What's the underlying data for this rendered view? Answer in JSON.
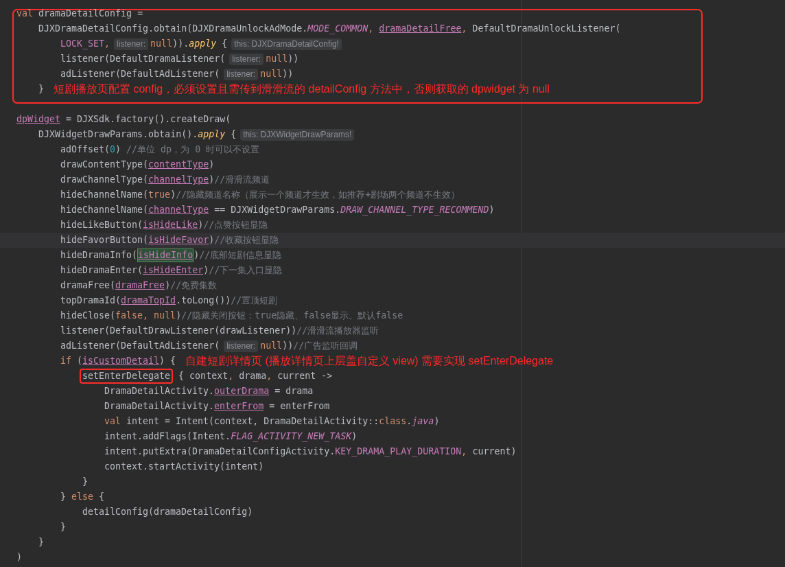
{
  "editor": {
    "blocks": [
      {
        "framed": true,
        "lines": [
          {
            "current": false,
            "tokens": [
              {
                "kind": "keyword",
                "text": "val"
              },
              {
                "kind": "plain",
                "text": " dramaDetailConfig ="
              }
            ],
            "children": [
              {
                "current": false,
                "tokens": [
                  {
                    "kind": "plain",
                    "text": "DJXDramaDetailConfig.obtain(DJXDramaUnlockAdMode."
                  },
                  {
                    "kind": "constant",
                    "text": "MODE_COMMON"
                  },
                  {
                    "kind": "keyword",
                    "text": ", "
                  },
                  {
                    "kind": "property",
                    "text": "dramaDetailFree"
                  },
                  {
                    "kind": "keyword",
                    "text": ","
                  },
                  {
                    "kind": "plain",
                    "text": " DefaultDramaUnlockListener("
                  }
                ],
                "children": [
                  {
                    "current": false,
                    "tokens": [
                      {
                        "kind": "field",
                        "text": "LOCK_SET"
                      },
                      {
                        "kind": "keyword",
                        "text": ","
                      },
                      {
                        "kind": "hint",
                        "text": "listener:"
                      },
                      {
                        "kind": "keyword",
                        "text": "null"
                      },
                      {
                        "kind": "plain",
                        "text": "))."
                      },
                      {
                        "kind": "call",
                        "text": "apply"
                      },
                      {
                        "kind": "plain",
                        "text": " {"
                      },
                      {
                        "kind": "hint",
                        "text": "this: DJXDramaDetailConfig!"
                      }
                    ]
                  },
                  {
                    "current": false,
                    "tokens": [
                      {
                        "kind": "plain",
                        "text": "listener(DefaultDramaListener("
                      },
                      {
                        "kind": "hint",
                        "text": "listener:"
                      },
                      {
                        "kind": "keyword",
                        "text": "null"
                      },
                      {
                        "kind": "plain",
                        "text": "))"
                      }
                    ]
                  },
                  {
                    "current": false,
                    "tokens": [
                      {
                        "kind": "plain",
                        "text": "adListener(DefaultAdListener("
                      },
                      {
                        "kind": "hint",
                        "text": "listener:"
                      },
                      {
                        "kind": "keyword",
                        "text": "null"
                      },
                      {
                        "kind": "plain",
                        "text": "))"
                      }
                    ]
                  }
                ]
              },
              {
                "current": false,
                "tokens": [
                  {
                    "kind": "plain",
                    "text": "}"
                  },
                  {
                    "kind": "note",
                    "text": "短剧播放页配置 config，必须设置且需传到滑滑流的 detailConfig 方法中，否则获取的 dpwidget 为 null"
                  }
                ]
              }
            ]
          }
        ]
      },
      {
        "framed": false,
        "lines": [
          {
            "current": false,
            "tokens": [
              {
                "kind": "property",
                "text": "dpWidget"
              },
              {
                "kind": "plain",
                "text": " = DJXSdk.factory().createDraw("
              }
            ],
            "children": [
              {
                "current": false,
                "tokens": [
                  {
                    "kind": "plain",
                    "text": "DJXWidgetDrawParams.obtain()."
                  },
                  {
                    "kind": "call",
                    "text": "apply"
                  },
                  {
                    "kind": "plain",
                    "text": " {"
                  },
                  {
                    "kind": "hint",
                    "text": "this: DJXWidgetDrawParams!"
                  }
                ],
                "children": [
                  {
                    "current": false,
                    "tokens": [
                      {
                        "kind": "plain",
                        "text": "adOffset("
                      },
                      {
                        "kind": "number",
                        "text": "0"
                      },
                      {
                        "kind": "plain",
                        "text": ")"
                      },
                      {
                        "kind": "comment",
                        "text": " //单位 dp，为 0 时可以不设置"
                      }
                    ]
                  },
                  {
                    "current": false,
                    "tokens": [
                      {
                        "kind": "plain",
                        "text": "drawContentType("
                      },
                      {
                        "kind": "property",
                        "text": "contentType"
                      },
                      {
                        "kind": "plain",
                        "text": ")"
                      }
                    ]
                  },
                  {
                    "current": false,
                    "tokens": [
                      {
                        "kind": "plain",
                        "text": "drawChannelType("
                      },
                      {
                        "kind": "property",
                        "text": "channelType"
                      },
                      {
                        "kind": "plain",
                        "text": ")"
                      },
                      {
                        "kind": "comment",
                        "text": "//滑滑流频道"
                      }
                    ]
                  },
                  {
                    "current": false,
                    "tokens": [
                      {
                        "kind": "plain",
                        "text": "hideChannelName("
                      },
                      {
                        "kind": "keyword",
                        "text": "true"
                      },
                      {
                        "kind": "plain",
                        "text": ")"
                      },
                      {
                        "kind": "comment",
                        "text": "//隐藏频道名称（展示一个频道才生效，如推荐+剧场两个频道不生效）"
                      }
                    ]
                  },
                  {
                    "current": false,
                    "tokens": [
                      {
                        "kind": "plain",
                        "text": "hideChannelName("
                      },
                      {
                        "kind": "property",
                        "text": "channelType"
                      },
                      {
                        "kind": "plain",
                        "text": " == DJXWidgetDrawParams."
                      },
                      {
                        "kind": "constant",
                        "text": "DRAW_CHANNEL_TYPE_RECOMMEND"
                      },
                      {
                        "kind": "plain",
                        "text": ")"
                      }
                    ]
                  },
                  {
                    "current": false,
                    "tokens": [
                      {
                        "kind": "plain",
                        "text": "hideLikeButton("
                      },
                      {
                        "kind": "property",
                        "text": "isHideLike"
                      },
                      {
                        "kind": "plain",
                        "text": ")"
                      },
                      {
                        "kind": "comment",
                        "text": "//点赞按钮显隐"
                      }
                    ]
                  },
                  {
                    "current": true,
                    "tokens": [
                      {
                        "kind": "plain",
                        "text": "hideFavorButton("
                      },
                      {
                        "kind": "property",
                        "text": "isHideFavor"
                      },
                      {
                        "kind": "plain",
                        "text": ")"
                      },
                      {
                        "kind": "comment",
                        "text": "//收藏按钮显隐"
                      }
                    ]
                  },
                  {
                    "current": false,
                    "tokens": [
                      {
                        "kind": "plain",
                        "text": "hideDramaInfo("
                      },
                      {
                        "kind": "match",
                        "text": "isHideInfo"
                      },
                      {
                        "kind": "plain",
                        "text": ")"
                      },
                      {
                        "kind": "comment",
                        "text": "//底部短剧信息显隐"
                      }
                    ]
                  },
                  {
                    "current": false,
                    "tokens": [
                      {
                        "kind": "plain",
                        "text": "hideDramaEnter("
                      },
                      {
                        "kind": "property",
                        "text": "isHideEnter"
                      },
                      {
                        "kind": "plain",
                        "text": ")"
                      },
                      {
                        "kind": "comment",
                        "text": "//下一集入口显隐"
                      }
                    ]
                  },
                  {
                    "current": false,
                    "tokens": [
                      {
                        "kind": "plain",
                        "text": "dramaFree("
                      },
                      {
                        "kind": "property",
                        "text": "dramaFree"
                      },
                      {
                        "kind": "plain",
                        "text": ")"
                      },
                      {
                        "kind": "comment",
                        "text": "//免费集数"
                      }
                    ]
                  },
                  {
                    "current": false,
                    "tokens": [
                      {
                        "kind": "plain",
                        "text": "topDramaId("
                      },
                      {
                        "kind": "property",
                        "text": "dramaTopId"
                      },
                      {
                        "kind": "plain",
                        "text": ".toLong())"
                      },
                      {
                        "kind": "comment",
                        "text": "//置顶短剧"
                      }
                    ]
                  },
                  {
                    "current": false,
                    "tokens": [
                      {
                        "kind": "plain",
                        "text": "hideClose("
                      },
                      {
                        "kind": "keyword",
                        "text": "false, null"
                      },
                      {
                        "kind": "plain",
                        "text": ")"
                      },
                      {
                        "kind": "comment",
                        "text": "//隐藏关闭按钮：true隐藏、false显示。默认false"
                      }
                    ]
                  },
                  {
                    "current": false,
                    "tokens": [
                      {
                        "kind": "plain",
                        "text": "listener(DefaultDrawListener(drawListener))"
                      },
                      {
                        "kind": "comment",
                        "text": "//滑滑流播放器监听"
                      }
                    ]
                  },
                  {
                    "current": false,
                    "tokens": [
                      {
                        "kind": "plain",
                        "text": "adListener(DefaultAdListener("
                      },
                      {
                        "kind": "hint",
                        "text": "listener:"
                      },
                      {
                        "kind": "keyword",
                        "text": "null"
                      },
                      {
                        "kind": "plain",
                        "text": "))"
                      },
                      {
                        "kind": "comment",
                        "text": "//广告监听回调"
                      }
                    ]
                  },
                  {
                    "current": false,
                    "tokens": [
                      {
                        "kind": "keyword",
                        "text": "if"
                      },
                      {
                        "kind": "plain",
                        "text": " ("
                      },
                      {
                        "kind": "property",
                        "text": "isCustomDetail"
                      },
                      {
                        "kind": "plain",
                        "text": ") {"
                      },
                      {
                        "kind": "note",
                        "text": "自建短剧详情页 (播放详情页上层盖自定义 view) 需要实现 setEnterDelegate"
                      }
                    ],
                    "children": [
                      {
                        "current": false,
                        "tokens": [
                          {
                            "kind": "framed",
                            "text": "setEnterDelegate"
                          },
                          {
                            "kind": "plain",
                            "text": " { context"
                          },
                          {
                            "kind": "keyword",
                            "text": ","
                          },
                          {
                            "kind": "plain",
                            "text": " drama"
                          },
                          {
                            "kind": "keyword",
                            "text": ","
                          },
                          {
                            "kind": "plain",
                            "text": " current ->"
                          }
                        ],
                        "children": [
                          {
                            "current": false,
                            "tokens": [
                              {
                                "kind": "plain",
                                "text": "DramaDetailActivity."
                              },
                              {
                                "kind": "property",
                                "text": "outerDrama"
                              },
                              {
                                "kind": "plain",
                                "text": " = drama"
                              }
                            ]
                          },
                          {
                            "current": false,
                            "tokens": [
                              {
                                "kind": "plain",
                                "text": "DramaDetailActivity."
                              },
                              {
                                "kind": "property",
                                "text": "enterFrom"
                              },
                              {
                                "kind": "plain",
                                "text": " = enterFrom"
                              }
                            ]
                          },
                          {
                            "current": false,
                            "tokens": [
                              {
                                "kind": "keyword",
                                "text": "val"
                              },
                              {
                                "kind": "plain",
                                "text": " intent = Intent(context, DramaDetailActivity::"
                              },
                              {
                                "kind": "keyword",
                                "text": "class"
                              },
                              {
                                "kind": "plain",
                                "text": "."
                              },
                              {
                                "kind": "constant",
                                "text": "java"
                              },
                              {
                                "kind": "plain",
                                "text": ")"
                              }
                            ]
                          },
                          {
                            "current": false,
                            "tokens": [
                              {
                                "kind": "plain",
                                "text": "intent.addFlags(Intent."
                              },
                              {
                                "kind": "constant",
                                "text": "FLAG_ACTIVITY_NEW_TASK"
                              },
                              {
                                "kind": "plain",
                                "text": ")"
                              }
                            ]
                          },
                          {
                            "current": false,
                            "tokens": [
                              {
                                "kind": "plain",
                                "text": "intent.putExtra(DramaDetailConfigActivity."
                              },
                              {
                                "kind": "field",
                                "text": "KEY_DRAMA_PLAY_DURATION"
                              },
                              {
                                "kind": "keyword",
                                "text": ","
                              },
                              {
                                "kind": "plain",
                                "text": " current)"
                              }
                            ]
                          },
                          {
                            "current": false,
                            "tokens": [
                              {
                                "kind": "plain",
                                "text": "context.startActivity(intent)"
                              }
                            ]
                          }
                        ]
                      },
                      {
                        "current": false,
                        "tokens": [
                          {
                            "kind": "plain",
                            "text": "}"
                          }
                        ]
                      }
                    ]
                  },
                  {
                    "current": false,
                    "tokens": [
                      {
                        "kind": "plain",
                        "text": "} "
                      },
                      {
                        "kind": "keyword",
                        "text": "else"
                      },
                      {
                        "kind": "plain",
                        "text": " {"
                      }
                    ],
                    "children": [
                      {
                        "current": false,
                        "tokens": [
                          {
                            "kind": "plain",
                            "text": "detailConfig(dramaDetailConfig)"
                          }
                        ]
                      }
                    ]
                  },
                  {
                    "current": false,
                    "tokens": [
                      {
                        "kind": "plain",
                        "text": "}"
                      }
                    ]
                  }
                ]
              },
              {
                "current": false,
                "tokens": [
                  {
                    "kind": "plain",
                    "text": "}"
                  }
                ]
              }
            ]
          },
          {
            "current": false,
            "tokens": [
              {
                "kind": "plain",
                "text": ")"
              }
            ]
          }
        ]
      }
    ]
  }
}
